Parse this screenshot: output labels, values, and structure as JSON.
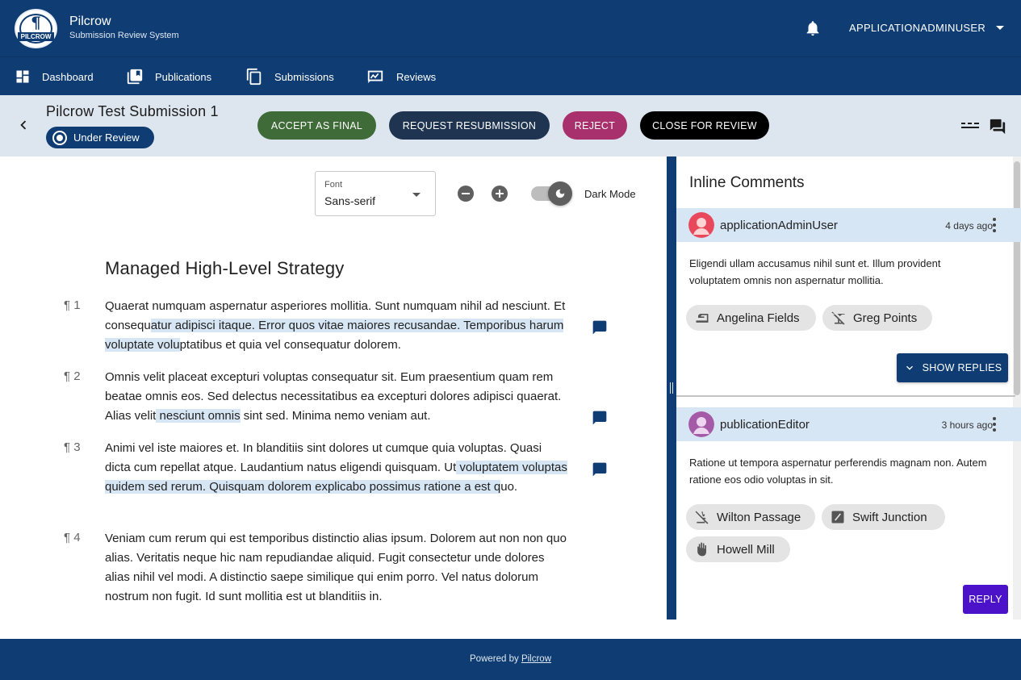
{
  "header": {
    "logo_text": "PILCROW",
    "brand_name": "Pilcrow",
    "brand_subtitle": "Submission Review System",
    "user_name": "APPLICATIONADMINUSER"
  },
  "nav": {
    "items": [
      {
        "label": "Dashboard",
        "icon": "dashboard-icon"
      },
      {
        "label": "Publications",
        "icon": "publications-icon"
      },
      {
        "label": "Submissions",
        "icon": "submissions-icon"
      },
      {
        "label": "Reviews",
        "icon": "reviews-icon"
      }
    ]
  },
  "submission": {
    "title": "Pilcrow Test Submission 1",
    "status": "Under Review",
    "actions": {
      "accept": "ACCEPT AS FINAL",
      "resubmit": "REQUEST RESUBMISSION",
      "reject": "REJECT",
      "close": "CLOSE FOR REVIEW"
    }
  },
  "toolbar": {
    "font_label": "Font",
    "font_value": "Sans-serif",
    "dark_mode_label": "Dark Mode",
    "dark_mode_on": true
  },
  "document": {
    "title": "Managed High-Level Strategy",
    "paragraphs": [
      {
        "num": "¶ 1",
        "before": "Quaerat numquam aspernatur asperiores mollitia. Sunt numquam nihil ad nesciunt. Et consequ",
        "highlight": "atur adipisci itaque. Error quos vitae maiores recusandae. Temporibus harum voluptate volu",
        "after": "ptatibus et quia vel consequatur dolorem."
      },
      {
        "num": "¶ 2",
        "before": "Omnis velit placeat excepturi voluptas consequatur sit. Eum praesentium quam rem beatae omnis eos. Sed delectus necessitatibus ea excepturi dolores adipisci quaerat. Alias velit",
        "highlight": " nesciunt omnis",
        "after": " sint sed. Minima nemo veniam aut."
      },
      {
        "num": "¶ 3",
        "before": "Animi vel iste maiores et. In blanditiis sint dolores ut cumque quia voluptas. Quasi dicta cum repellat atque. Laudantium natus eligendi quisquam. Ut",
        "highlight": " voluptatem voluptas quidem sed rerum. Quisquam dolorem explicabo possimus ratione a est q",
        "after": "uo."
      },
      {
        "num": "¶ 4",
        "before": "Veniam cum rerum qui est temporibus distinctio alias ipsum. Dolorem aut non non quo alias. Veritatis neque hic nam repudiandae aliquid. Fugit consectetur unde dolores alias nihil vel modi. A distinctio saepe similique qui enim porro. Vel natus dolorum nostrum non fugit. Id sunt mollitia est ut blanditiis in.",
        "highlight": "",
        "after": ""
      }
    ]
  },
  "comments_panel": {
    "title": "Inline Comments",
    "comments": [
      {
        "user": "applicationAdminUser",
        "time": "4 days ago",
        "body": "Eligendi ullam accusamus nihil sunt et. Illum provident voluptatem omnis non aspernatur mollitia.",
        "tags": [
          "Angelina Fields",
          "Greg Points"
        ],
        "show_replies": "SHOW REPLIES",
        "avatar_color": "#e8475c"
      },
      {
        "user": "publicationEditor",
        "time": "3 hours ago",
        "body": "Ratione ut tempora aspernatur perferendis magnam non. Autem ratione eos odio voluptas in sit.",
        "tags": [
          "Wilton Passage",
          "Swift Junction",
          "Howell Mill"
        ],
        "reply": "REPLY",
        "avatar_color": "#a55aa7"
      }
    ]
  },
  "footer": {
    "prefix": "Powered by",
    "link": "Pilcrow"
  },
  "colors": {
    "primary": "#0f3d73",
    "accept": "#3e6b37",
    "resubmit": "#1e3450",
    "reject": "#a8306d",
    "close": "#000000",
    "highlight": "#d7e6f4",
    "reply": "#4b12c9"
  }
}
